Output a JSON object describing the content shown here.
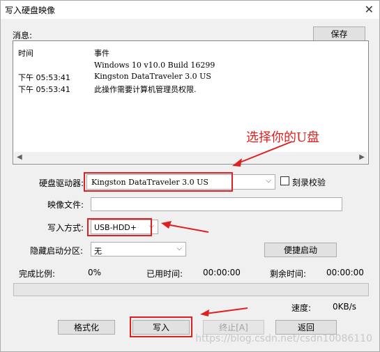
{
  "window": {
    "title": "写入硬盘映像",
    "close_icon": "close-icon"
  },
  "log": {
    "section_label": "消息:",
    "save_button": "保存",
    "col_time": "时间",
    "col_event": "事件",
    "rows": [
      {
        "time": "",
        "event": "Windows 10 v10.0 Build 16299"
      },
      {
        "time": "下午 05:53:41",
        "event": "Kingston DataTraveler 3.0 US"
      },
      {
        "time": "下午 05:53:41",
        "event": "此操作需要计算机管理员权限."
      }
    ]
  },
  "form": {
    "drive_label": "硬盘驱动器:",
    "drive_value": "Kingston DataTraveler 3.0 US",
    "verify_label": "刻录校验",
    "verify_checked": false,
    "image_label": "映像文件:",
    "image_value": "",
    "write_mode_label": "写入方式:",
    "write_mode_value": "USB-HDD+",
    "hidden_partition_label": "隐藏启动分区:",
    "hidden_partition_value": "无",
    "quick_boot_button": "便捷启动"
  },
  "status": {
    "percent_label": "完成比例:",
    "percent_value": "0%",
    "elapsed_label": "已用时间:",
    "elapsed_value": "00:00:00",
    "remaining_label": "剩余时间:",
    "remaining_value": "00:00:00",
    "speed_label": "速度:",
    "speed_value": "0KB/s",
    "progress": 0
  },
  "buttons": {
    "format": "格式化",
    "write": "写入",
    "stop": "终止[A]",
    "back": "返回"
  },
  "annotation": {
    "text": "选择你的U盘",
    "color": "#e02020"
  },
  "watermark": "https://blog.csdn.net/csdn10086110"
}
